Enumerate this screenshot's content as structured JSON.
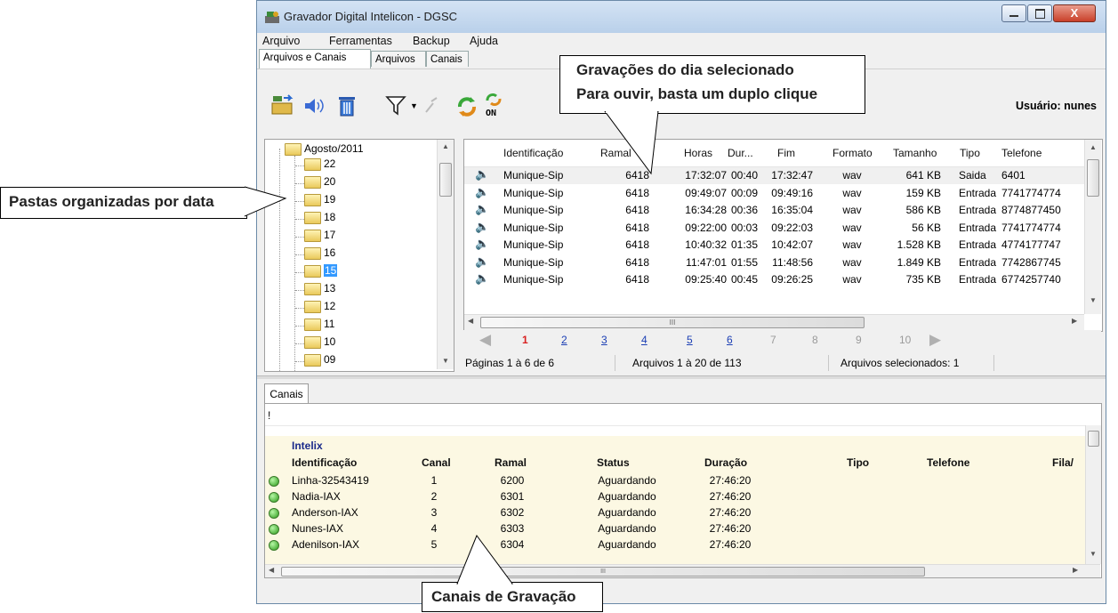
{
  "window": {
    "title": "Gravador Digital Intelicon - DGSC",
    "close_glyph": "X"
  },
  "menu": [
    "Arquivo",
    "Ferramentas",
    "Backup",
    "Ajuda"
  ],
  "tabs": [
    "Arquivos e Canais",
    "Arquivos",
    "Canais"
  ],
  "toolbar": {
    "user_label": "Usuário: nunes",
    "on_label": "ON"
  },
  "tree": {
    "root": "Agosto/2011",
    "folders": [
      "22",
      "20",
      "19",
      "18",
      "17",
      "16",
      "15",
      "13",
      "12",
      "11",
      "10",
      "09"
    ],
    "selected": "15"
  },
  "grid": {
    "columns": [
      "Identificação",
      "Ramal",
      "Horas",
      "Dur...",
      "Fim",
      "Formato",
      "Tamanho",
      "Tipo",
      "Telefone"
    ],
    "rows": [
      [
        "Munique-Sip",
        "6418",
        "17:32:07",
        "00:40",
        "17:32:47",
        "wav",
        "641 KB",
        "Saida",
        "6401"
      ],
      [
        "Munique-Sip",
        "6418",
        "09:49:07",
        "00:09",
        "09:49:16",
        "wav",
        "159 KB",
        "Entrada",
        "7741774774"
      ],
      [
        "Munique-Sip",
        "6418",
        "16:34:28",
        "00:36",
        "16:35:04",
        "wav",
        "586 KB",
        "Entrada",
        "8774877450"
      ],
      [
        "Munique-Sip",
        "6418",
        "09:22:00",
        "00:03",
        "09:22:03",
        "wav",
        "56 KB",
        "Entrada",
        "7741774774"
      ],
      [
        "Munique-Sip",
        "6418",
        "10:40:32",
        "01:35",
        "10:42:07",
        "wav",
        "1.528 KB",
        "Entrada",
        "4774177747"
      ],
      [
        "Munique-Sip",
        "6418",
        "11:47:01",
        "01:55",
        "11:48:56",
        "wav",
        "1.849 KB",
        "Entrada",
        "7742867745"
      ],
      [
        "Munique-Sip",
        "6418",
        "09:25:40",
        "00:45",
        "09:26:25",
        "wav",
        "735 KB",
        "Entrada",
        "6774257740"
      ]
    ],
    "hscroll_grip": "III"
  },
  "pager": {
    "pages": [
      "1",
      "2",
      "3",
      "4",
      "5",
      "6",
      "7",
      "8",
      "9",
      "10"
    ],
    "current": "1"
  },
  "status": {
    "pages": "Páginas 1 à 6 de 6",
    "files": "Arquivos 1 à 20 de 113",
    "selected": "Arquivos selecionados: 1"
  },
  "bottom": {
    "tab": "Canais",
    "marker": "!",
    "group": "Intelix",
    "columns": [
      "Identificação",
      "Canal",
      "Ramal",
      "Status",
      "Duração",
      "Tipo",
      "Telefone",
      "Fila/"
    ],
    "rows": [
      [
        "Linha-32543419",
        "1",
        "6200",
        "Aguardando",
        "27:46:20"
      ],
      [
        "Nadia-IAX",
        "2",
        "6301",
        "Aguardando",
        "27:46:20"
      ],
      [
        "Anderson-IAX",
        "3",
        "6302",
        "Aguardando",
        "27:46:20"
      ],
      [
        "Nunes-IAX",
        "4",
        "6303",
        "Aguardando",
        "27:46:20"
      ],
      [
        "Adenilson-IAX",
        "5",
        "6304",
        "Aguardando",
        "27:46:20"
      ]
    ],
    "hscroll_grip": "III"
  },
  "callouts": {
    "top_line1": "Gravações do dia selecionado",
    "top_line2": "Para ouvir, basta um duplo clique",
    "left": "Pastas organizadas por data",
    "bottom": "Canais de Gravação"
  },
  "colors": {
    "titlebar": "#c8dcf0",
    "link": "#1c3fb4",
    "current_page": "#d82020",
    "group_header": "#1a2a8a",
    "channel_bg": "#fcf8e3"
  }
}
